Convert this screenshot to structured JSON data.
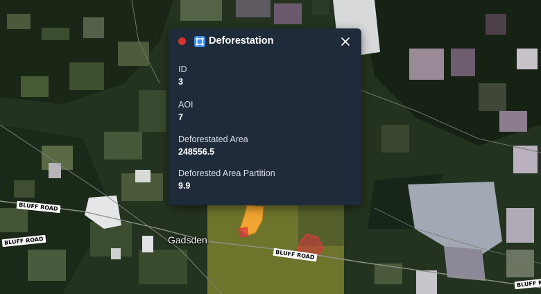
{
  "map": {
    "place_label": "Gadsden",
    "road_labels": [
      "BLUFF ROAD",
      "BLUFF ROAD",
      "BLUFF ROAD",
      "BLUFF ROAD"
    ]
  },
  "popup": {
    "title": "Deforestation",
    "status_color": "#d9322e",
    "icon": "polygon-icon",
    "icon_color": "#3d8ef7",
    "attributes": [
      {
        "label": "ID",
        "value": "3"
      },
      {
        "label": "AOI",
        "value": "7"
      },
      {
        "label": "Deforestated Area",
        "value": "248556.5"
      },
      {
        "label": "Deforested Area Partition",
        "value": "9.9"
      }
    ]
  },
  "colors": {
    "aoi_overlay": "#c9c43c",
    "deforestation_orange": "#f0a431",
    "deforestation_red": "#d8343c",
    "popup_background": "#1f2b3b"
  }
}
